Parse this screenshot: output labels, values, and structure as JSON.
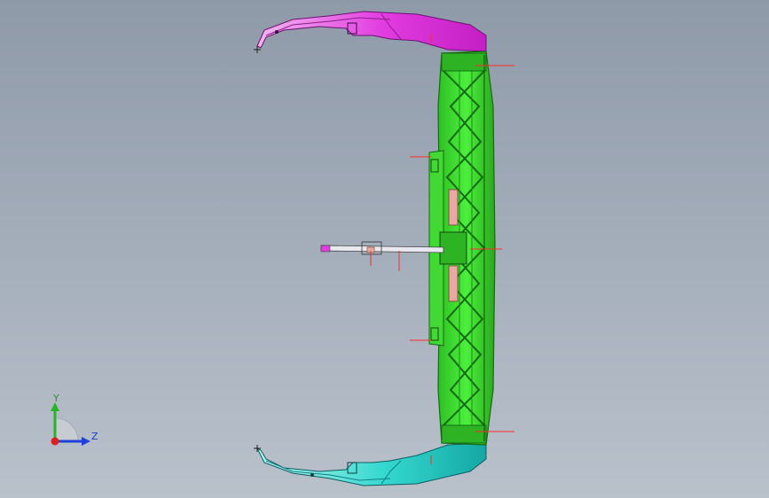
{
  "viewport": {
    "background_top": "#8f9aa9",
    "background_bottom": "#b9c1cb"
  },
  "model": {
    "colors": {
      "top_arm": "#e23ce0",
      "top_arm_dark": "#9c1fa0",
      "bottom_arm": "#35d9cf",
      "bottom_arm_dark": "#137f82",
      "frame": "#37e52a",
      "frame_dark": "#146b12",
      "inner_insert": "#e8a9a0",
      "rod": "#e8e8f0",
      "dimension_marker": "#ff2a2a"
    }
  },
  "triad": {
    "y_label": "Y",
    "z_label": "Z",
    "y_color": "#22b822",
    "z_color": "#1f3fd6",
    "origin_color": "#e02020"
  }
}
